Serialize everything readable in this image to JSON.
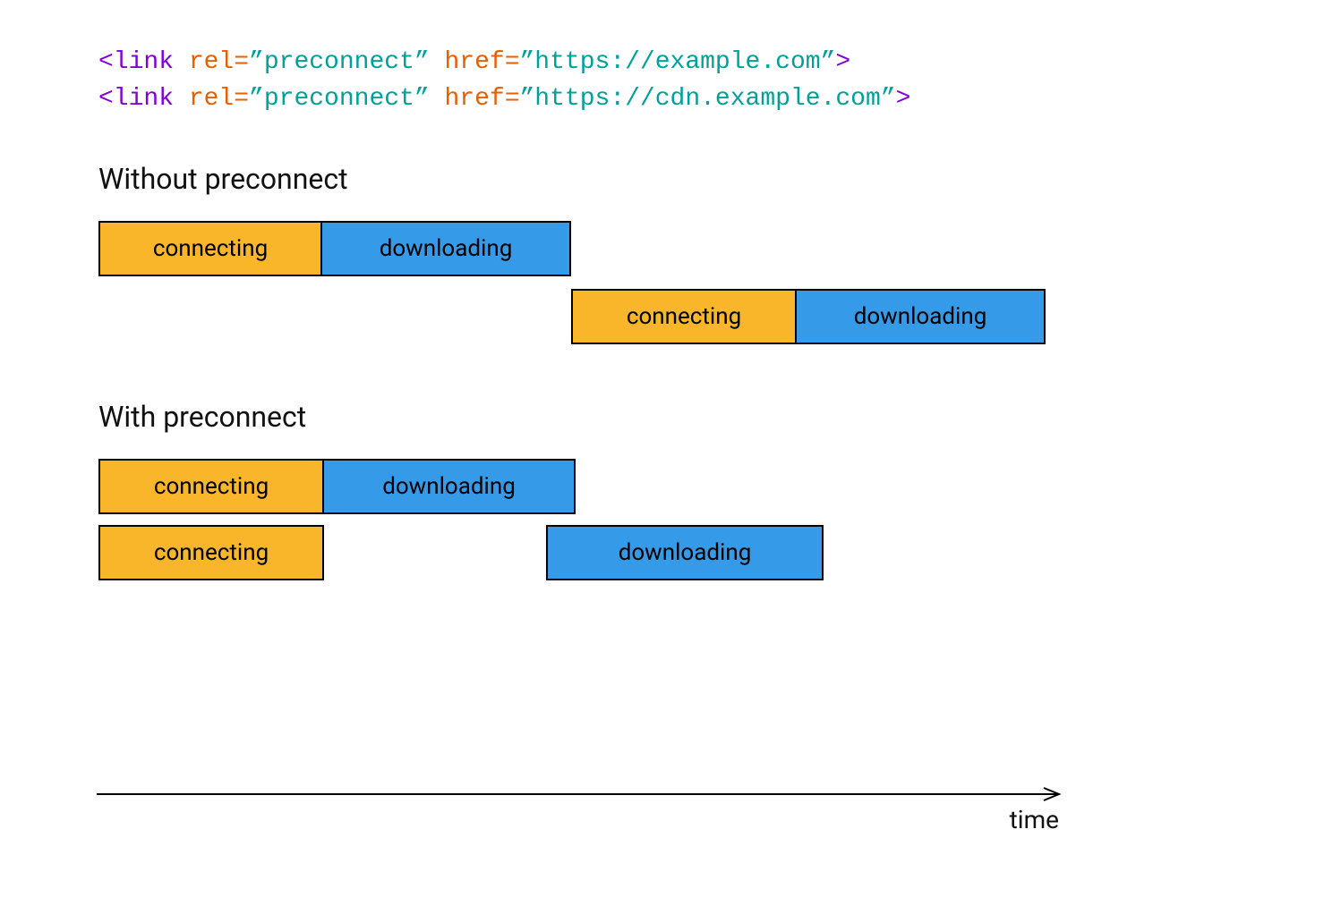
{
  "code": {
    "line1": {
      "p1": "<link ",
      "p2": "rel=",
      "p3": "”preconnect” ",
      "p4": "href=",
      "p5": "”https://example.com”",
      "p6": ">"
    },
    "line2": {
      "p1": "<link ",
      "p2": "rel=",
      "p3": "”preconnect” ",
      "p4": "href=",
      "p5": "”https://cdn.example.com”",
      "p6": ">"
    }
  },
  "sections": {
    "without": {
      "title": "Without preconnect"
    },
    "with": {
      "title": "With preconnect"
    }
  },
  "labels": {
    "connecting": "connecting",
    "downloading": "downloading"
  },
  "axis": {
    "label": "time"
  }
}
